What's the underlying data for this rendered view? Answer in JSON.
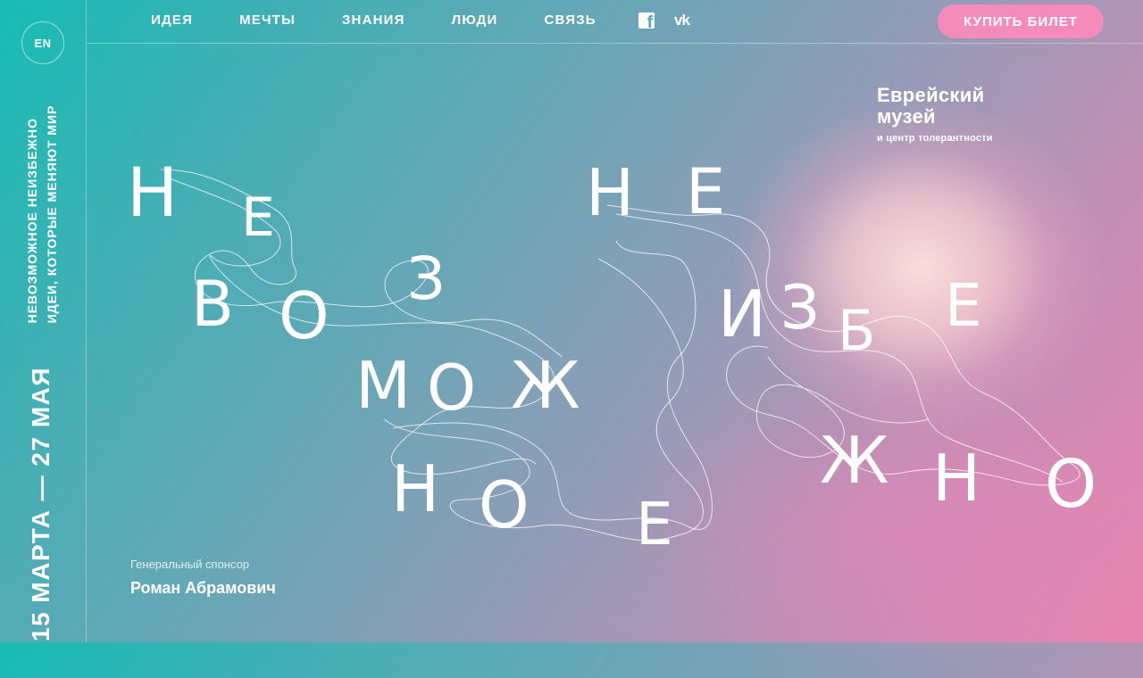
{
  "header": {
    "lang": "EN",
    "nav": [
      "ИДЕЯ",
      "МЕЧТЫ",
      "ЗНАНИЯ",
      "ЛЮДИ",
      "СВЯЗЬ"
    ],
    "buy_label": "КУПИТЬ БИЛЕТ",
    "icons": [
      "facebook-icon",
      "vk-icon"
    ]
  },
  "sidebar": {
    "tagline_line1": "НЕВОЗМОЖНОЕ НЕИЗБЕЖНО",
    "tagline_line2": "ИДЕИ, КОТОРЫЕ МЕНЯЮТ МИР",
    "dates": "15 МАРТА — 27 МАЯ"
  },
  "logo": {
    "line1": "Еврейский",
    "line2": "музей",
    "line3": "и центр толерантности"
  },
  "sponsor": {
    "caption": "Генеральный спонсор",
    "name": "Роман Абрамович"
  },
  "headline": {
    "word1": [
      "Н",
      "Е",
      "В",
      "О",
      "З",
      "М",
      "О",
      "Ж",
      "Н",
      "О",
      "Е"
    ],
    "word2": [
      "Н",
      "Е",
      "И",
      "З",
      "Б",
      "Е",
      "Ж",
      "Н",
      "О"
    ]
  },
  "colors": {
    "accent": "#f48cbb",
    "teal": "#17bcb4",
    "pink": "#ea84b2"
  }
}
